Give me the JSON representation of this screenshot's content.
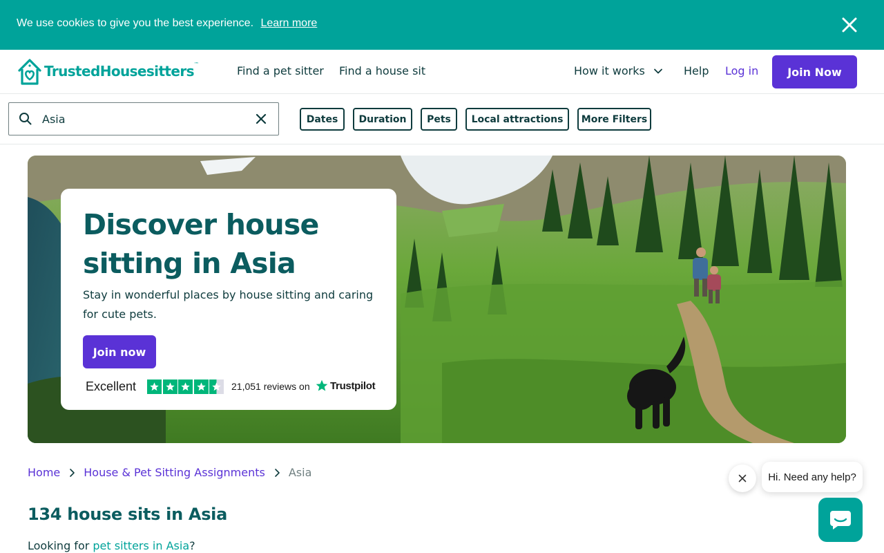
{
  "colors": {
    "brand_teal": "#00a39a",
    "brand_purple": "#5a32d6",
    "heading_teal": "#0b5c5f",
    "text_dark": "#0e3b3d",
    "trustpilot_green": "#00b67a"
  },
  "cookie_banner": {
    "text": "We use cookies to give you the best experience.",
    "link": "Learn more",
    "close_icon": "close-icon"
  },
  "header": {
    "logo_text": "TrustedHousesitters",
    "logo_tm": "™",
    "nav": {
      "find_sitter": "Find a pet sitter",
      "find_house_sit": "Find a house sit",
      "how_it_works": "How it works",
      "help": "Help",
      "login": "Log in",
      "join": "Join Now"
    }
  },
  "search": {
    "value": "Asia",
    "icons": [
      "search-icon",
      "clear-icon"
    ]
  },
  "filters": {
    "dates": "Dates",
    "duration": "Duration",
    "pets": "Pets",
    "local_attractions": "Local attractions",
    "more_filters": "More Filters"
  },
  "hero": {
    "title": "Discover house sitting in Asia",
    "subtitle": "Stay in wonderful places by house sitting and caring for cute pets.",
    "cta": "Join now",
    "trustpilot": {
      "rating_word": "Excellent",
      "stars": 4.5,
      "reviews": "21,051 reviews on",
      "brand": "Trustpilot"
    }
  },
  "breadcrumb": {
    "home": "Home",
    "assignments": "House & Pet Sitting Assignments",
    "current": "Asia"
  },
  "results": {
    "title": "134 house sits in Asia",
    "looking_prefix": "Looking for ",
    "looking_link": "pet sitters in Asia",
    "looking_suffix": "?"
  },
  "chat": {
    "bubble": "Hi. Need any help?"
  }
}
